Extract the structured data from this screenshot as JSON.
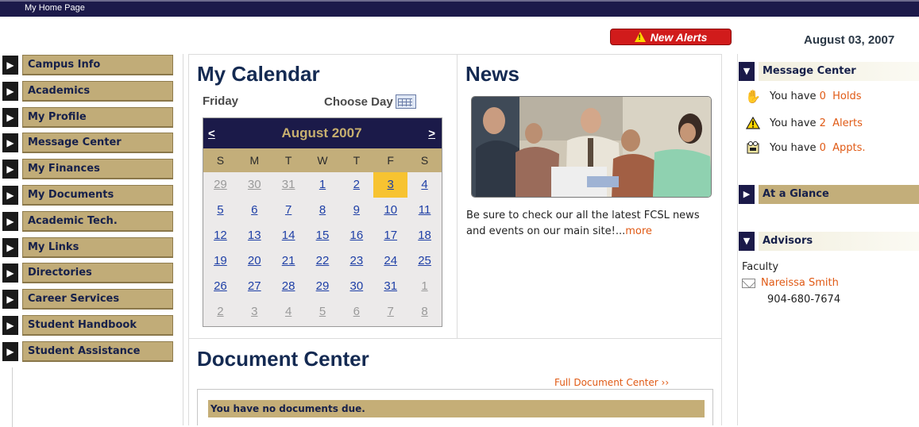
{
  "titlebar": {
    "title": "My Home Page"
  },
  "header": {
    "alert_label": "New Alerts",
    "date": "August 03, 2007"
  },
  "nav": {
    "items": [
      {
        "label": "Campus Info"
      },
      {
        "label": "Academics"
      },
      {
        "label": "My Profile"
      },
      {
        "label": "Message Center"
      },
      {
        "label": "My Finances"
      },
      {
        "label": "My Documents"
      },
      {
        "label": "Academic Tech."
      },
      {
        "label": "My Links"
      },
      {
        "label": "Directories"
      },
      {
        "label": "Career Services"
      },
      {
        "label": "Student Handbook"
      },
      {
        "label": "Student Assistance"
      }
    ]
  },
  "calendar": {
    "title": "My Calendar",
    "day_name": "Friday",
    "choose_day": "Choose Day",
    "prev": "<",
    "next": ">",
    "month": "August 2007",
    "dow": [
      "S",
      "M",
      "T",
      "W",
      "T",
      "F",
      "S"
    ],
    "days": [
      {
        "d": "29",
        "muted": true
      },
      {
        "d": "30",
        "muted": true
      },
      {
        "d": "31",
        "muted": true
      },
      {
        "d": "1"
      },
      {
        "d": "2"
      },
      {
        "d": "3",
        "today": true
      },
      {
        "d": "4"
      },
      {
        "d": "5"
      },
      {
        "d": "6"
      },
      {
        "d": "7"
      },
      {
        "d": "8"
      },
      {
        "d": "9"
      },
      {
        "d": "10"
      },
      {
        "d": "11"
      },
      {
        "d": "12"
      },
      {
        "d": "13"
      },
      {
        "d": "14"
      },
      {
        "d": "15"
      },
      {
        "d": "16"
      },
      {
        "d": "17"
      },
      {
        "d": "18"
      },
      {
        "d": "19"
      },
      {
        "d": "20"
      },
      {
        "d": "21"
      },
      {
        "d": "22"
      },
      {
        "d": "23"
      },
      {
        "d": "24"
      },
      {
        "d": "25"
      },
      {
        "d": "26"
      },
      {
        "d": "27"
      },
      {
        "d": "28"
      },
      {
        "d": "29"
      },
      {
        "d": "30"
      },
      {
        "d": "31"
      },
      {
        "d": "1",
        "muted": true
      },
      {
        "d": "2",
        "muted": true
      },
      {
        "d": "3",
        "muted": true
      },
      {
        "d": "4",
        "muted": true
      },
      {
        "d": "5",
        "muted": true
      },
      {
        "d": "6",
        "muted": true
      },
      {
        "d": "7",
        "muted": true
      },
      {
        "d": "8",
        "muted": true
      }
    ]
  },
  "news": {
    "title": "News",
    "text": "Be sure to check our all the latest FCSL news and events on our main site!...",
    "more": "more"
  },
  "documents": {
    "title": "Document Center",
    "full_link": "Full Document Center ››",
    "status": "You have no documents due."
  },
  "message_center": {
    "title": "Message Center",
    "lines": [
      {
        "prefix": "You have",
        "count": "0",
        "word": "Holds",
        "icon": "hand-icon"
      },
      {
        "prefix": "You have",
        "count": "2",
        "word": "Alerts",
        "icon": "warning-icon"
      },
      {
        "prefix": "You have",
        "count": "0",
        "word": "Appts.",
        "icon": "appointment-icon"
      }
    ]
  },
  "glance": {
    "title": "At a Glance"
  },
  "advisors": {
    "title": "Advisors",
    "role": "Faculty",
    "name": "Nareissa Smith",
    "phone": "904-680-7674"
  },
  "colors": {
    "navy": "#1b1a49",
    "tan": "#c3ae7a",
    "link_orange": "#e05a15",
    "link_blue": "#1e3fa6",
    "alert_red": "#d11b1b",
    "today_yellow": "#f7c331"
  }
}
